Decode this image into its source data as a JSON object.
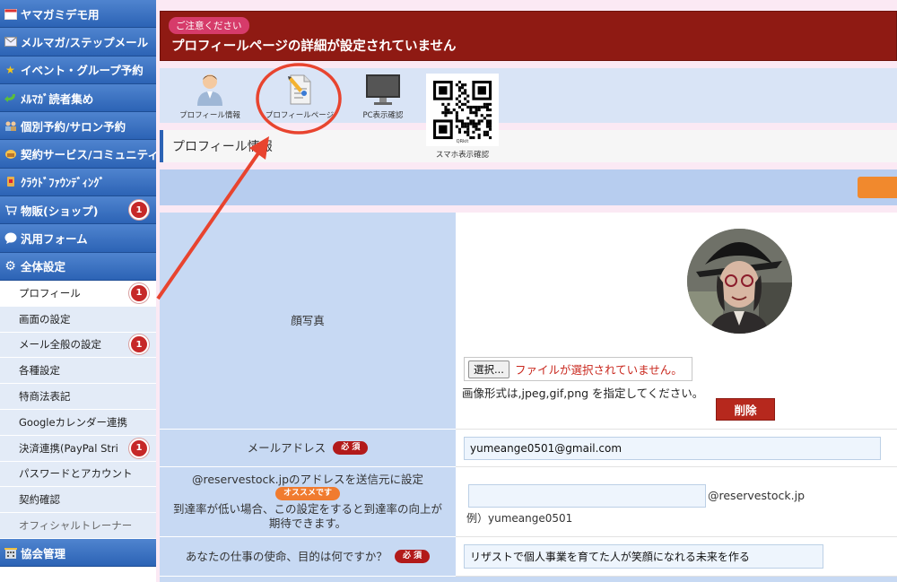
{
  "sidebar": {
    "top_items": [
      {
        "label": "ヤマガミデモ用",
        "icon": "calendar-icon"
      },
      {
        "label": "メルマガ/ステップメール",
        "icon": "mail-icon"
      },
      {
        "label": "イベント・グループ予約",
        "icon": "star-icon"
      },
      {
        "label": "ﾒﾙﾏｶﾞ読者集め",
        "icon": "green-arrow-icon"
      },
      {
        "label": "個別予約/サロン予約",
        "icon": "people-icon"
      },
      {
        "label": "契約サービス/コミュニティ",
        "icon": "service-icon"
      },
      {
        "label": "ｸﾗｳﾄﾞﾌｧｳﾝﾃﾞｨﾝｸﾞ",
        "icon": "crowdfunding-icon"
      },
      {
        "label": "物販(ショップ)",
        "icon": "shop-icon",
        "badge": "1"
      },
      {
        "label": "汎用フォーム",
        "icon": "bubble-icon"
      },
      {
        "label": "全体設定",
        "icon": "gear-icon"
      }
    ],
    "sub_items": [
      {
        "label": "プロフィール",
        "badge": "1",
        "active": true
      },
      {
        "label": "画面の設定"
      },
      {
        "label": "メール全般の設定",
        "badge": "1"
      },
      {
        "label": "各種設定"
      },
      {
        "label": "特商法表記"
      },
      {
        "label": "Googleカレンダー連携"
      },
      {
        "label": "決済連携(PayPal Stri",
        "badge": "1"
      },
      {
        "label": "パスワードとアカウント"
      },
      {
        "label": "契約確認"
      },
      {
        "label": "オフィシャルトレーナー",
        "muted": true
      }
    ],
    "bottom_item": {
      "label": "協会管理",
      "icon": "building-icon"
    }
  },
  "alert": {
    "tag": "ご注意ください",
    "message": "プロフィールページの詳細が設定されていません"
  },
  "toolbar": {
    "items": [
      {
        "label": "プロフィール情報",
        "icon": "user-profile-icon"
      },
      {
        "label": "プロフィールページ",
        "icon": "profile-page-edit-icon"
      },
      {
        "label": "PC表示確認",
        "icon": "monitor-icon"
      }
    ],
    "qr": {
      "label": "スマホ表示確認",
      "sublabel": "QRkit",
      "icon": "qr-code-icon"
    }
  },
  "section": {
    "title": "プロフィール情報"
  },
  "form": {
    "photo": {
      "label": "顔写真",
      "file_button": "選択...",
      "file_status": "ファイルが選択されていません。",
      "format_note": "画像形式は,jpeg,gif,png を指定してください。",
      "delete_button": "削除"
    },
    "email": {
      "label": "メールアドレス",
      "required": "必 須",
      "value": "yumeange0501@gmail.com"
    },
    "reserve_address": {
      "label_line1": "@reservestock.jpのアドレスを送信元に設定",
      "recommend": "オススメです",
      "label_line2": "到達率が低い場合、この設定をすると到達率の向上が期待できます。",
      "value": "",
      "suffix": "@reservestock.jp",
      "example": "例）yumeange0501"
    },
    "mission": {
      "label": "あなたの仕事の使命、目的は何ですか？",
      "required": "必 須",
      "value": "リザストで個人事業を育てた人が笑顔になれる未来を作る"
    }
  },
  "colors": {
    "sidebar_blue": "#2c63b5",
    "alert_red": "#8f1a13",
    "badge_red": "#c62828",
    "annotation_red": "#e8442f",
    "orange": "#f1892d"
  }
}
